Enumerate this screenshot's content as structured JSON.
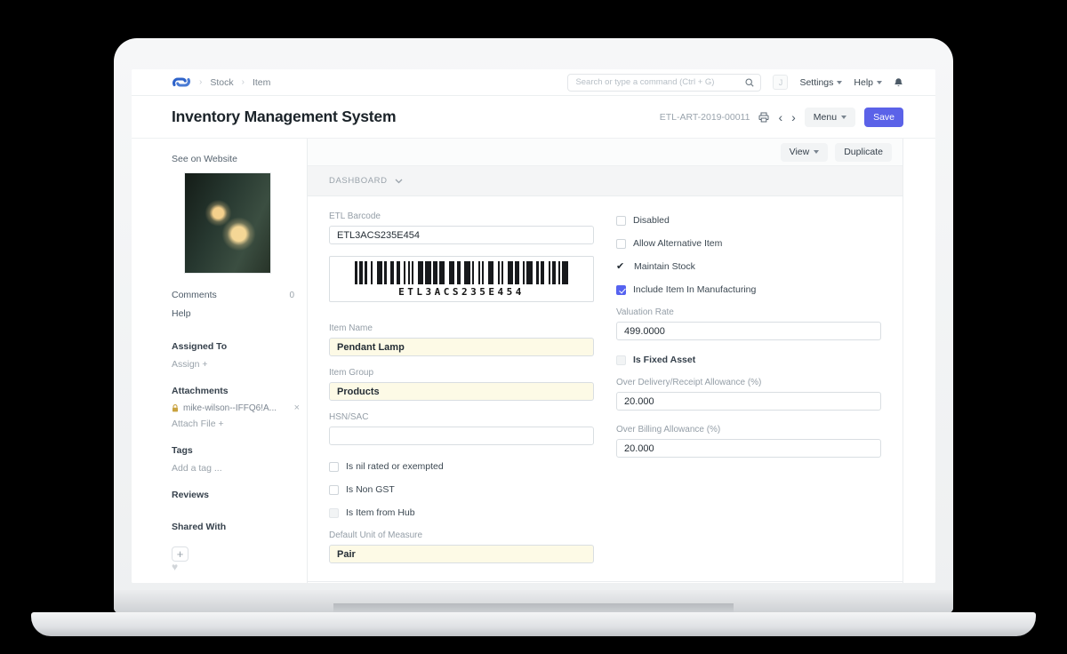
{
  "colors": {
    "accent": "#5b62e8",
    "checkbox_checked": "#5663f0",
    "filled_field_bg": "#fdfae6",
    "logo_blue": "#3566c4"
  },
  "navbar": {
    "breadcrumbs": [
      "Stock",
      "Item"
    ],
    "search_placeholder": "Search or type a command (Ctrl + G)",
    "avatar_initial": "J",
    "settings_label": "Settings",
    "help_label": "Help"
  },
  "header": {
    "title": "Inventory Management System",
    "doc_id": "ETL-ART-2019-00011",
    "menu_label": "Menu",
    "save_label": "Save"
  },
  "toolbar": {
    "view_label": "View",
    "duplicate_label": "Duplicate"
  },
  "section": {
    "dashboard_label": "DASHBOARD"
  },
  "sidebar": {
    "see_on_website": "See on Website",
    "comments_label": "Comments",
    "comments_count": "0",
    "help_label": "Help",
    "assigned_to_label": "Assigned To",
    "assign_action": "Assign +",
    "attachments_label": "Attachments",
    "attachment_name": "mike-wilson--IFFQ6!A...",
    "remove_attachment_label": "×",
    "attach_action": "Attach File +",
    "tags_label": "Tags",
    "add_tag_placeholder": "Add a tag ...",
    "reviews_label": "Reviews",
    "shared_with_label": "Shared With",
    "add_share_label": "+"
  },
  "form": {
    "left": {
      "etl_barcode": {
        "label": "ETL Barcode",
        "value": "ETL3ACS235E454"
      },
      "item_name": {
        "label": "Item Name",
        "value": "Pendant Lamp"
      },
      "item_group": {
        "label": "Item Group",
        "value": "Products"
      },
      "hsn_sac": {
        "label": "HSN/SAC",
        "value": ""
      },
      "checkboxes": [
        {
          "label": "Is nil rated or exempted",
          "state": "unchecked"
        },
        {
          "label": "Is Non GST",
          "state": "unchecked"
        },
        {
          "label": "Is Item from Hub",
          "state": "disabled"
        }
      ],
      "uom": {
        "label": "Default Unit of Measure",
        "value": "Pair"
      }
    },
    "right": {
      "checkboxes": [
        {
          "label": "Disabled",
          "state": "unchecked"
        },
        {
          "label": "Allow Alternative Item",
          "state": "unchecked"
        },
        {
          "label": "Maintain Stock",
          "state": "checked"
        },
        {
          "label": "Include Item In Manufacturing",
          "state": "checked-filled"
        }
      ],
      "valuation_rate": {
        "label": "Valuation Rate",
        "value": "499.0000"
      },
      "is_fixed_asset": {
        "label": "Is Fixed Asset",
        "state": "disabled"
      },
      "over_delivery": {
        "label": "Over Delivery/Receipt Allowance (%)",
        "value": "20.000"
      },
      "over_billing": {
        "label": "Over Billing Allowance (%)",
        "value": "20.000"
      }
    }
  }
}
